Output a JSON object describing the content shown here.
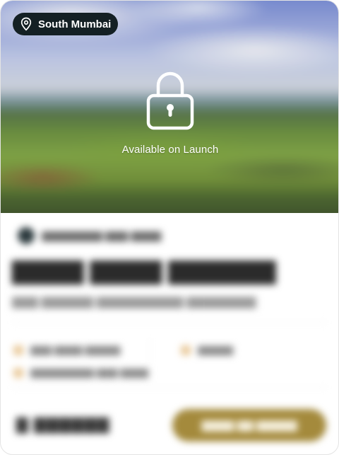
{
  "hero": {
    "location": "South Mumbai",
    "location_icon": "map-pin-icon",
    "lock_icon": "padlock-icon",
    "status_text": "Available on Launch"
  },
  "colors": {
    "pill_bg": "#142024",
    "accent": "#a48a3c",
    "title_text": "#2b2b2b"
  }
}
